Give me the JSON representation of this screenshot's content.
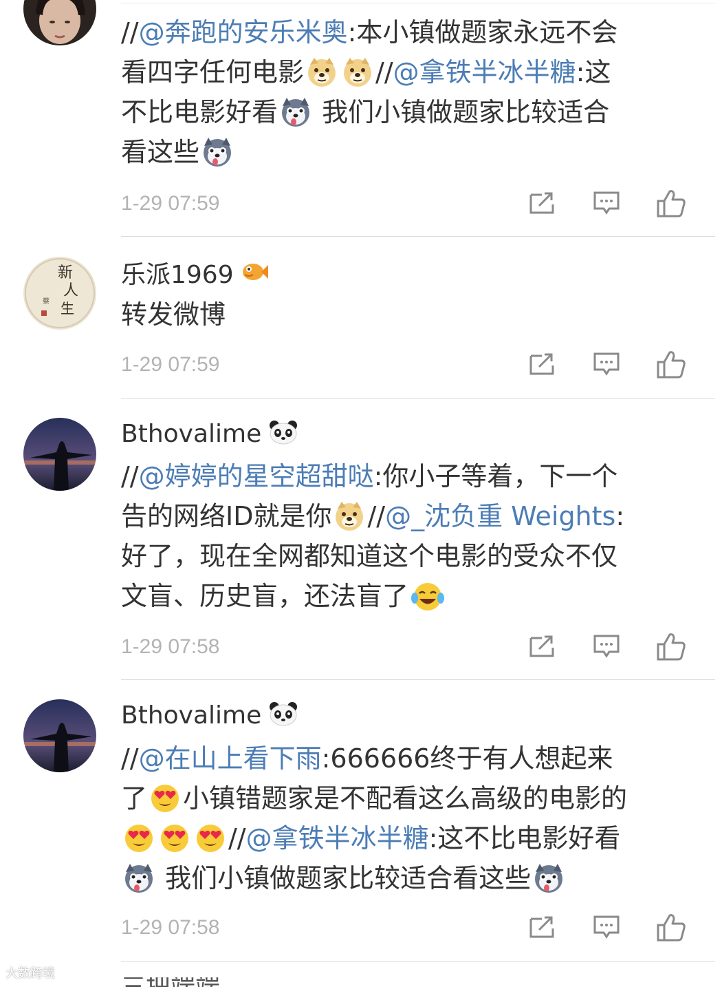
{
  "comments": [
    {
      "lines": [
        [
          {
            "t": "//"
          },
          {
            "m": "@奔跑的安乐米奥"
          },
          {
            "t": ":本小镇做题家永远不会"
          }
        ],
        [
          {
            "t": "看四字任何电影"
          },
          {
            "e": "doge"
          },
          {
            "e": "doge"
          },
          {
            "t": "//"
          },
          {
            "m": "@拿铁半冰半糖"
          },
          {
            "t": ":这"
          }
        ],
        [
          {
            "t": "不比电影好看"
          },
          {
            "e": "husky"
          },
          {
            "t": " 我们小镇做题家比较适合"
          }
        ],
        [
          {
            "t": "看这些"
          },
          {
            "e": "husky"
          }
        ]
      ],
      "timestamp": "1-29 07:59"
    },
    {
      "username": "乐派1969",
      "lines": [
        [
          {
            "t": "转发微博"
          }
        ]
      ],
      "timestamp": "1-29 07:59"
    },
    {
      "username": "Bthovalime",
      "lines": [
        [
          {
            "t": "//"
          },
          {
            "m": "@婷婷的星空超甜哒"
          },
          {
            "t": ":你小子等着，下一个"
          }
        ],
        [
          {
            "t": "告的网络ID就是你"
          },
          {
            "e": "doge"
          },
          {
            "t": "//"
          },
          {
            "m": "@_沈负重 Weights"
          },
          {
            "t": ":"
          }
        ],
        [
          {
            "t": "好了，现在全网都知道这个电影的受众不仅"
          }
        ],
        [
          {
            "t": "文盲、历史盲，还法盲了"
          },
          {
            "e": "laugh-cry"
          }
        ]
      ],
      "timestamp": "1-29 07:58"
    },
    {
      "username": "Bthovalime",
      "lines": [
        [
          {
            "t": "//"
          },
          {
            "m": "@在山上看下雨"
          },
          {
            "t": ":666666终于有人想起来"
          }
        ],
        [
          {
            "t": "了"
          },
          {
            "e": "heart-eyes"
          },
          {
            "t": "小镇错题家是不配看这么高级的电影的"
          }
        ],
        [
          {
            "e": "heart-eyes"
          },
          {
            "e": "heart-eyes"
          },
          {
            "e": "heart-eyes"
          },
          {
            "t": "//"
          },
          {
            "m": "@拿铁半冰半糖"
          },
          {
            "t": ":这不比电影好看"
          }
        ],
        [
          {
            "e": "husky"
          },
          {
            "t": " 我们小镇做题家比较适合看这些"
          },
          {
            "e": "husky"
          }
        ]
      ],
      "timestamp": "1-29 07:58"
    }
  ],
  "actions": [
    "share-icon",
    "comment-icon",
    "like-icon"
  ],
  "colors": {
    "mention": "#4c7db5",
    "text": "#333333",
    "timestamp": "#b3b3b3",
    "divider": "#dcdcdc"
  },
  "watermark": "大数跨境",
  "next_preview": "三把端端"
}
